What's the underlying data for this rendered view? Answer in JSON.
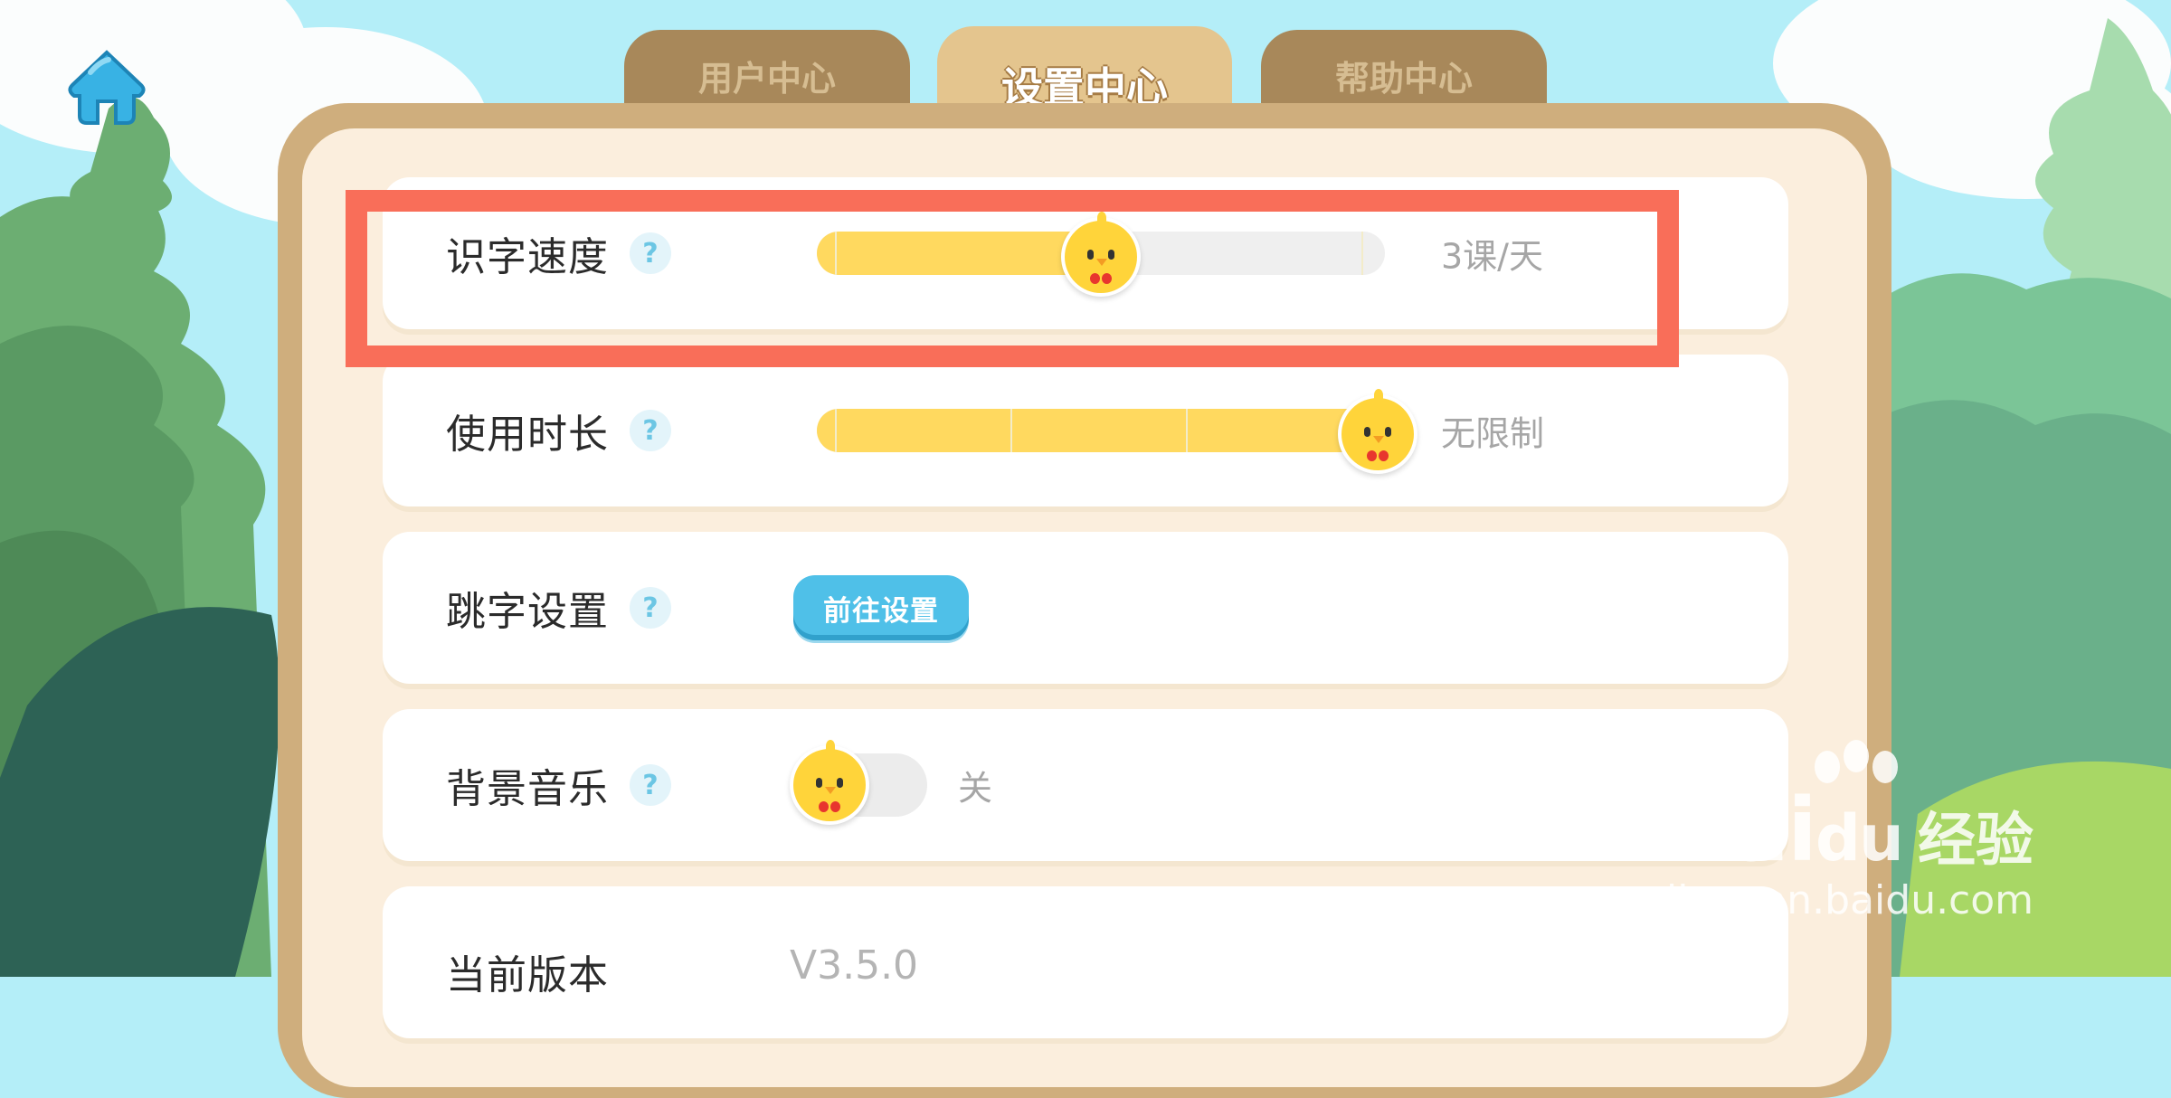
{
  "tabs": [
    {
      "label": "用户中心",
      "active": false
    },
    {
      "label": "设置中心",
      "active": true
    },
    {
      "label": "帮助中心",
      "active": false
    }
  ],
  "settings": {
    "literacy_speed": {
      "label": "识字速度",
      "help": "?",
      "value": "3课/天",
      "level_fraction": 0.5
    },
    "usage_duration": {
      "label": "使用时长",
      "help": "?",
      "value": "无限制",
      "level_fraction": 1.0
    },
    "skip_words": {
      "label": "跳字设置",
      "help": "?",
      "button": "前往设置"
    },
    "background_music": {
      "label": "背景音乐",
      "help": "?",
      "state": "关"
    },
    "version": {
      "label": "当前版本",
      "value": "V3.5.0"
    }
  },
  "watermark": {
    "brand": "Bai",
    "brand2": "du",
    "suffix": "经验",
    "url": "jingyan.baidu.com"
  },
  "colors": {
    "accent": "#ffd95f",
    "highlight": "#f96e59",
    "button": "#4fc0e8"
  }
}
